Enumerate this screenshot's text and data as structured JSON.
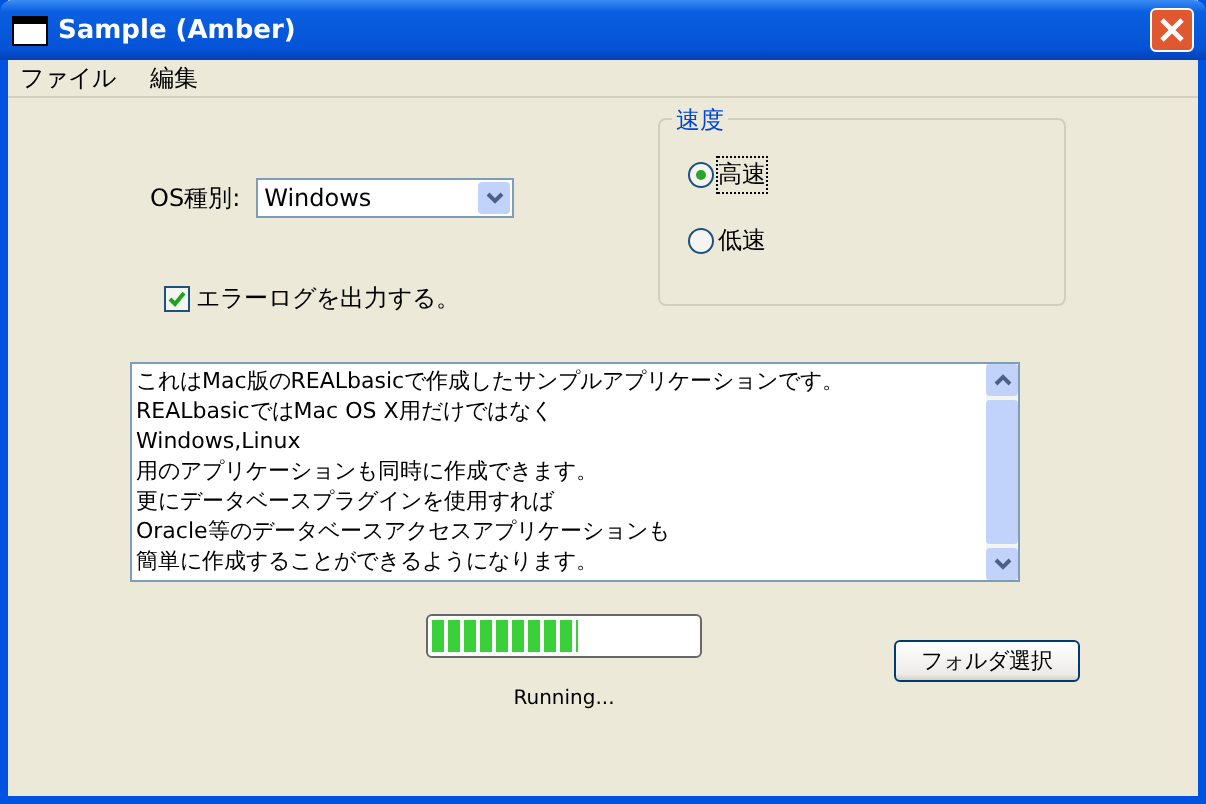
{
  "window": {
    "title": "Sample (Amber)"
  },
  "menu": [
    {
      "label": "ファイル"
    },
    {
      "label": "編集"
    }
  ],
  "os_field": {
    "label": "OS種別:",
    "value": "Windows"
  },
  "error_log": {
    "label": "エラーログを出力する。",
    "checked": true
  },
  "speed": {
    "title": "速度",
    "options": [
      {
        "label": "高速",
        "selected": true
      },
      {
        "label": "低速",
        "selected": false
      }
    ]
  },
  "text_area": {
    "lines": [
      "これはMac版のREALbasicで作成したサンプルアプリケーションです。",
      "REALbasicではMac OS X用だけではなく",
      "Windows,Linux",
      "用のアプリケーションも同時に作成できます。",
      "更にデータベースプラグインを使用すれば",
      "Oracle等のデータベースアクセスアプリケーションも",
      "簡単に作成することができるようになります。"
    ]
  },
  "progress": {
    "level": 0.55
  },
  "status": "Running...",
  "folder_button": {
    "label": "フォルダ選択"
  }
}
